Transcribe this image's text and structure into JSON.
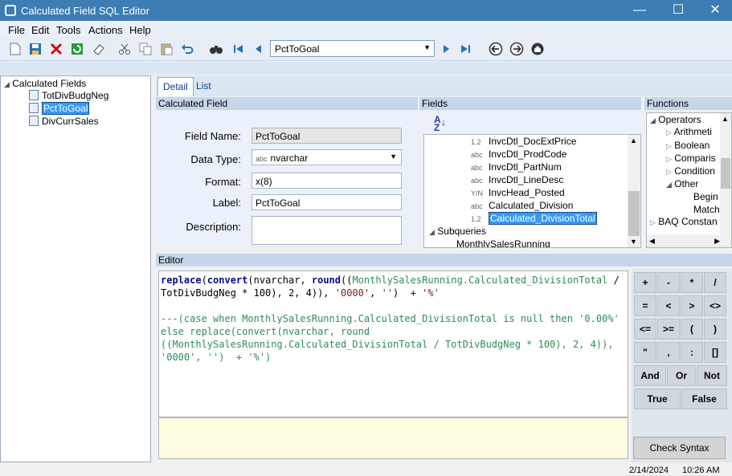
{
  "window": {
    "title": "Calculated Field SQL Editor",
    "min": "—",
    "max": "☐",
    "close": "✕"
  },
  "menu": [
    "File",
    "Edit",
    "Tools",
    "Actions",
    "Help"
  ],
  "toolbar": {
    "nav_value": "PctToGoal"
  },
  "tree": {
    "root": "Calculated Fields",
    "items": [
      "TotDivBudgNeg",
      "PctToGoal",
      "DivCurrSales"
    ],
    "selected": 1
  },
  "tabs": {
    "detail": "Detail",
    "list": "List"
  },
  "calc_field": {
    "header": "Calculated Field",
    "field_name_label": "Field Name:",
    "field_name": "PctToGoal",
    "data_type_label": "Data Type:",
    "data_type": "nvarchar",
    "data_type_icon": "abc",
    "format_label": "Format:",
    "format": "x(8)",
    "label_label": "Label:",
    "label": "PctToGoal",
    "description_label": "Description:",
    "description": ""
  },
  "fields": {
    "header": "Fields",
    "items": [
      {
        "type": "1.2",
        "name": "InvcDtl_DocExtPrice"
      },
      {
        "type": "abc",
        "name": "InvcDtl_ProdCode"
      },
      {
        "type": "abc",
        "name": "InvcDtl_PartNum"
      },
      {
        "type": "abc",
        "name": "InvcDtl_LineDesc"
      },
      {
        "type": "Y/N",
        "name": "InvcHead_Posted"
      },
      {
        "type": "abc",
        "name": "Calculated_Division"
      },
      {
        "type": "1.2",
        "name": "Calculated_DivisionTotal"
      }
    ],
    "subqueries": "Subqueries",
    "subquery_item": "MonthlySalesRunning"
  },
  "functions": {
    "header": "Functions",
    "items": [
      "Operators",
      "Arithmeti",
      "Boolean",
      "Comparis",
      "Condition",
      "Other",
      "Begin",
      "Match",
      "BAQ Constan"
    ]
  },
  "editor": {
    "header": "Editor",
    "l1a": "replace",
    "l1b": "(",
    "l1c": "convert",
    "l1d": "(nvarchar, ",
    "l1e": "round",
    "l1f": "((",
    "l1g": "MonthlySalesRunning.Calculated_DivisionTotal",
    "l1h": " /",
    "l2a": "TotDivBudgNeg",
    "l2b": " * 100), 2, 4)), ",
    "l2c": "'0000'",
    "l2d": ", ",
    "l2e": "''",
    "l2f": ")  + ",
    "l2g": "'%'",
    "c1": "---(case when MonthlySalesRunning.Calculated_DivisionTotal is null then '0.00%'",
    "c2": "else replace(convert(nvarchar, round",
    "c3": "((MonthlySalesRunning.Calculated_DivisionTotal / TotDivBudgNeg * 100), 2, 4)),",
    "c4": "'0000', '')  + '%')"
  },
  "keypad": {
    "keys": [
      "+",
      "-",
      "*",
      "/",
      "=",
      "<",
      ">",
      "<>",
      "<=",
      ">=",
      "(",
      ")",
      "\"",
      ",",
      ":",
      "[]"
    ],
    "and": "And",
    "or": "Or",
    "not": "Not",
    "true": "True",
    "false": "False",
    "check": "Check Syntax"
  },
  "status": {
    "date": "2/14/2024",
    "time": "10:26 AM"
  }
}
